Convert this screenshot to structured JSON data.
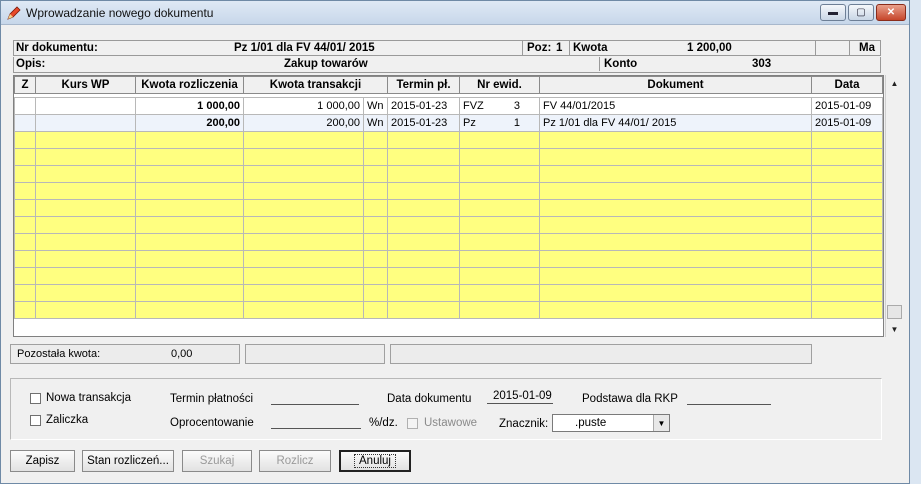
{
  "window": {
    "title": "Wprowadzanie nowego dokumentu"
  },
  "header": {
    "nr_label": "Nr dokumentu:",
    "nr_value": "Pz 1/01 dla FV 44/01/ 2015",
    "poz_label": "Poz:",
    "poz_value": "1",
    "kwota_label": "Kwota",
    "kwota_value": "1 200,00",
    "ma_label": "Ma",
    "opis_label": "Opis:",
    "opis_value": "Zakup towarów",
    "konto_label": "Konto",
    "konto_value": "303"
  },
  "grid": {
    "columns": [
      "Z",
      "Kurs WP",
      "Kwota rozliczenia",
      "Kwota transakcji",
      "",
      "Termin pł.",
      "Nr ewid.",
      "",
      "Dokument",
      "Data"
    ],
    "rows": [
      {
        "z": "",
        "kurs": "",
        "kwota_rozl": "1 000,00",
        "kwota_trans": "1 000,00",
        "strona": "Wn",
        "termin": "2015-01-23",
        "ewid_typ": "FVZ",
        "ewid_nr": "3",
        "dokument": "FV 44/01/2015",
        "data": "2015-01-09"
      },
      {
        "z": "",
        "kurs": "",
        "kwota_rozl": "200,00",
        "kwota_trans": "200,00",
        "strona": "Wn",
        "termin": "2015-01-23",
        "ewid_typ": "Pz",
        "ewid_nr": "1",
        "dokument": "Pz 1/01 dla FV 44/01/ 2015",
        "data": "2015-01-09"
      }
    ]
  },
  "status": {
    "pozostala_label": "Pozostała kwota:",
    "pozostala_value": "0,00"
  },
  "form": {
    "nowa_transakcja": "Nowa transakcja",
    "zaliczka": "Zaliczka",
    "termin_platnosci": "Termin płatności",
    "oprocentowanie": "Oprocentowanie",
    "proc_unit": "%/dz.",
    "ustawowe": "Ustawowe",
    "data_dokumentu_label": "Data dokumentu",
    "data_dokumentu_value": "2015-01-09",
    "podstawa_label": "Podstawa dla RKP",
    "znacznik_label": "Znacznik:",
    "znacznik_value": ".puste"
  },
  "buttons": {
    "zapisz": "Zapisz",
    "stan": "Stan rozliczeń...",
    "szukaj": "Szukaj",
    "rozlicz": "Rozlicz",
    "anuluj": "Anuluj"
  }
}
